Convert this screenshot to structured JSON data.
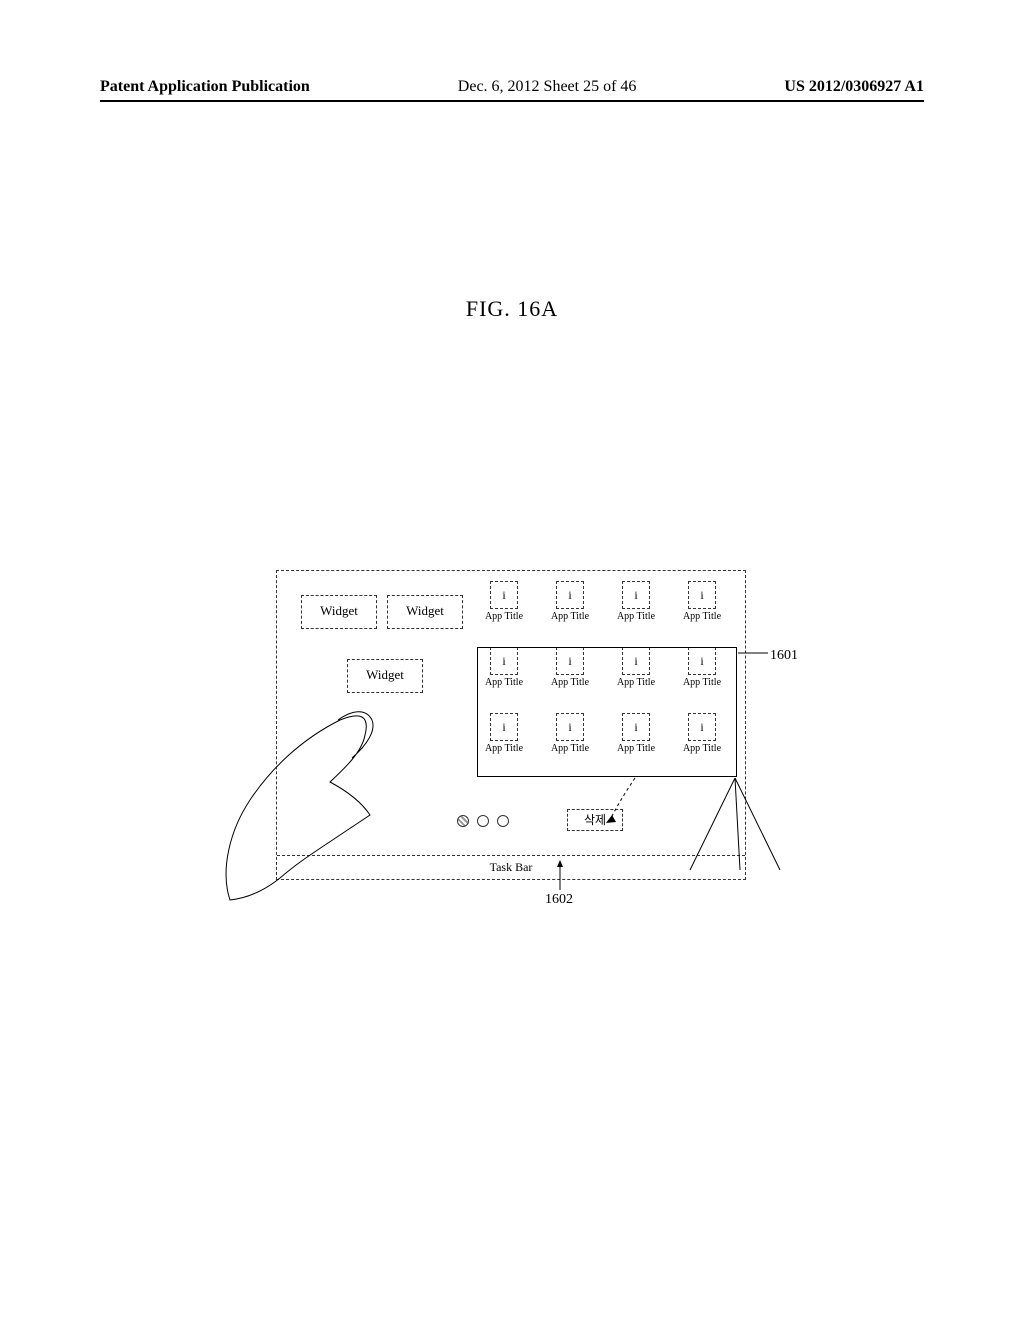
{
  "header": {
    "left": "Patent Application Publication",
    "mid": "Dec. 6, 2012   Sheet 25 of 46",
    "right": "US 2012/0306927 A1"
  },
  "figure_label": "FIG. 16A",
  "widgets": [
    "Widget",
    "Widget",
    "Widget"
  ],
  "app_rows": [
    [
      {
        "icon": "i",
        "title": "App Title"
      },
      {
        "icon": "i",
        "title": "App Title"
      },
      {
        "icon": "i",
        "title": "App Title"
      },
      {
        "icon": "i",
        "title": "App Title"
      }
    ],
    [
      {
        "icon": "i",
        "title": "App Title"
      },
      {
        "icon": "i",
        "title": "App Title"
      },
      {
        "icon": "i",
        "title": "App Title"
      },
      {
        "icon": "i",
        "title": "App Title"
      }
    ],
    [
      {
        "icon": "i",
        "title": "App Title"
      },
      {
        "icon": "i",
        "title": "App Title"
      },
      {
        "icon": "i",
        "title": "App Title"
      },
      {
        "icon": "i",
        "title": "App Title"
      }
    ]
  ],
  "delete_label": "삭제",
  "task_bar_label": "Task Bar",
  "refs": {
    "r1601": "1601",
    "r1602": "1602"
  }
}
